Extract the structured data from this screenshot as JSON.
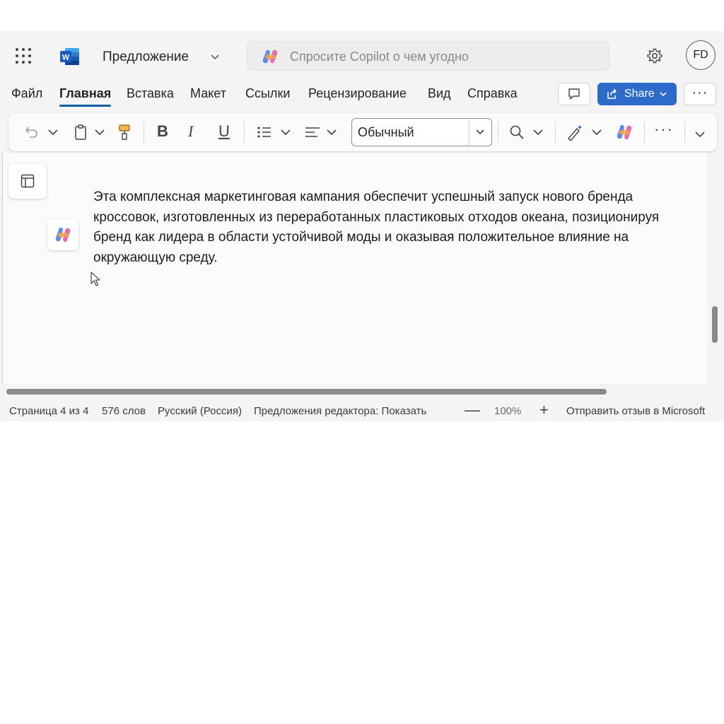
{
  "header": {
    "doc_title": "Предложение",
    "search_placeholder": "Спросите Copilot о чем угодно",
    "avatar_initials": "FD"
  },
  "tabs": [
    "Файл",
    "Главная",
    "Вставка",
    "Макет",
    "Ссылки",
    "Рецензирование",
    "Вид",
    "Справка"
  ],
  "active_tab": "Главная",
  "actions": {
    "share_label": "Share",
    "more_label": "···"
  },
  "ribbon": {
    "style_value": "Обычный",
    "bold": "B",
    "italic": "I",
    "underline": "U",
    "more": "···"
  },
  "document": {
    "paragraph": "Эта комплексная маркетинговая кампания обеспечит успешный запуск нового бренда кроссовок, изготовленных из переработанных пластиковых отходов океана, позиционируя бренд как лидера в области устойчивой моды и оказывая положительное влияние на окружающую среду."
  },
  "status": {
    "page": "Страница 4 из 4",
    "words": "576 слов",
    "language": "Русский (Россия)",
    "editor": "Предложения редактора: Показать",
    "zoom_out": "—",
    "zoom": "100%",
    "zoom_in": "+",
    "feedback": "Отправить отзыв в Microsoft"
  },
  "colors": {
    "accent": "#115ea3",
    "share_button": "#2d6ac9",
    "word_blue": "#185abd"
  },
  "icons": [
    "app-launcher-icon",
    "word-logo-icon",
    "chevron-down-icon",
    "copilot-icon",
    "gear-icon",
    "comment-icon",
    "share-icon",
    "undo-icon",
    "clipboard-icon",
    "format-painter-icon",
    "bullets-icon",
    "align-icon",
    "find-icon",
    "designer-icon",
    "side-panel-icon",
    "mouse-cursor-icon"
  ]
}
